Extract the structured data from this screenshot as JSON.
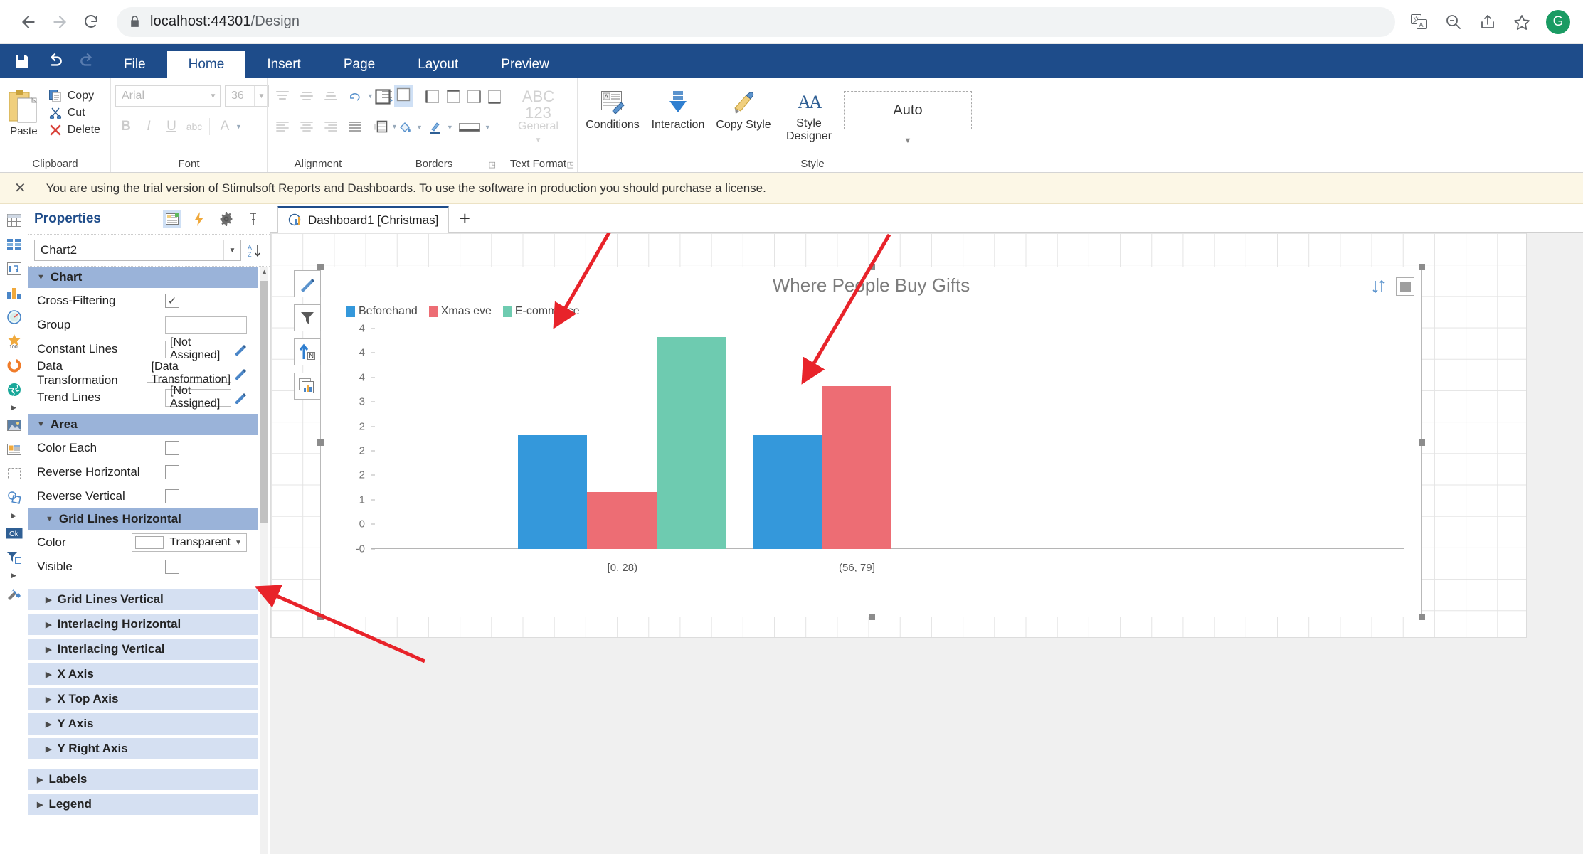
{
  "browser": {
    "url_host": "localhost:44301",
    "url_path": "/Design",
    "back_icon": "back-arrow-icon",
    "forward_icon": "forward-arrow-icon",
    "reload_icon": "reload-icon",
    "lock_icon": "lock-icon",
    "translate_icon": "translate-icon",
    "zoom_icon": "zoom-icon",
    "share_icon": "share-icon",
    "bookmark_icon": "star-icon",
    "avatar_letter": "G"
  },
  "ribbon": {
    "quick_access": [
      "save-icon",
      "undo-icon",
      "redo-icon"
    ],
    "tabs": [
      {
        "label": "File",
        "active": false
      },
      {
        "label": "Home",
        "active": true
      },
      {
        "label": "Insert",
        "active": false
      },
      {
        "label": "Page",
        "active": false
      },
      {
        "label": "Layout",
        "active": false
      },
      {
        "label": "Preview",
        "active": false
      }
    ],
    "groups": [
      {
        "name": "Clipboard"
      },
      {
        "name": "Font"
      },
      {
        "name": "Alignment"
      },
      {
        "name": "Borders"
      },
      {
        "name": "Text Format"
      },
      {
        "name": "Style"
      }
    ],
    "clipboard": {
      "paste": "Paste",
      "copy": "Copy",
      "cut": "Cut",
      "delete": "Delete"
    },
    "font": {
      "name_value": "Arial",
      "size_value": "36"
    },
    "text_format": {
      "sample_line1": "ABC",
      "sample_line2": "123",
      "sample_line3": "General"
    },
    "style": {
      "conditions": "Conditions",
      "interaction": "Interaction",
      "copy_style": "Copy Style",
      "style_designer": "Style\nDesigner",
      "style_designer_l1": "Style",
      "style_designer_l2": "Designer",
      "auto_value": "Auto"
    }
  },
  "trial": {
    "close_label": "✕",
    "message": "You are using the trial version of Stimulsoft Reports and Dashboards. To use the software in production you should purchase a license."
  },
  "rail_icons": [
    "table-icon",
    "blocks-icon",
    "form-icon",
    "chart-icon",
    "gauge-icon",
    "indicator-icon",
    "progress-icon",
    "map-icon",
    "more-icon-1",
    "image-icon",
    "panel-icon",
    "shape-icon",
    "shapes-icon",
    "more-icon-2",
    "button-icon",
    "filter-icon",
    "more-icon-3",
    "tools-icon"
  ],
  "properties": {
    "title": "Properties",
    "head_icons": [
      "properties-icon",
      "events-icon",
      "settings-icon",
      "pin-icon"
    ],
    "selected_object": "Chart2",
    "sort_icon": "sort-az-icon",
    "groups": [
      {
        "name": "Chart",
        "style": "dark",
        "expanded": true,
        "indent": false,
        "rows": [
          {
            "label": "Cross-Filtering",
            "type": "checkbox",
            "checked": true
          },
          {
            "label": "Group",
            "type": "textbox",
            "value": ""
          },
          {
            "label": "Constant Lines",
            "type": "textbox-edit",
            "value": "[Not Assigned]"
          },
          {
            "label": "Data Transformation",
            "type": "textbox-edit",
            "value": "[Data Transformation]"
          },
          {
            "label": "Trend Lines",
            "type": "textbox-edit",
            "value": "[Not Assigned]"
          }
        ]
      },
      {
        "name": "Area",
        "style": "dark",
        "expanded": true,
        "indent": false,
        "rows": [
          {
            "label": "Color Each",
            "type": "checkbox",
            "checked": false
          },
          {
            "label": "Reverse Horizontal",
            "type": "checkbox",
            "checked": false
          },
          {
            "label": "Reverse Vertical",
            "type": "checkbox",
            "checked": false
          }
        ]
      },
      {
        "name": "Grid Lines Horizontal",
        "style": "dark",
        "expanded": true,
        "indent": true,
        "rows": [
          {
            "label": "Color",
            "type": "color",
            "value": "Transparent"
          },
          {
            "label": "Visible",
            "type": "checkbox",
            "checked": false
          }
        ]
      },
      {
        "name": "Grid Lines Vertical",
        "style": "light",
        "expanded": false,
        "indent": true,
        "rows": []
      },
      {
        "name": "Interlacing Horizontal",
        "style": "light",
        "expanded": false,
        "indent": true,
        "rows": []
      },
      {
        "name": "Interlacing Vertical",
        "style": "light",
        "expanded": false,
        "indent": true,
        "rows": []
      },
      {
        "name": "X Axis",
        "style": "light",
        "expanded": false,
        "indent": true,
        "rows": []
      },
      {
        "name": "X Top Axis",
        "style": "light",
        "expanded": false,
        "indent": true,
        "rows": []
      },
      {
        "name": "Y Axis",
        "style": "light",
        "expanded": false,
        "indent": true,
        "rows": []
      },
      {
        "name": "Y Right Axis",
        "style": "light",
        "expanded": false,
        "indent": true,
        "rows": []
      },
      {
        "name": "Labels",
        "style": "light",
        "expanded": false,
        "indent": false,
        "rows": []
      },
      {
        "name": "Legend",
        "style": "light",
        "expanded": false,
        "indent": false,
        "rows": []
      }
    ]
  },
  "canvas": {
    "tab_label": "Dashboard1 [Christmas]",
    "tab_icon": "dashboard-icon",
    "add_tab_label": "+",
    "chart_tools": [
      "edit-pencil-icon",
      "filter-icon",
      "sort-n-icon",
      "chart-type-icon"
    ],
    "chart_top_right": [
      "sort-toggle-icon",
      "fullscreen-icon"
    ]
  },
  "chart_data": {
    "type": "bar",
    "title": "Where People Buy Gifts",
    "xlabel": "",
    "ylabel": "",
    "grid": false,
    "legend_position": "top-left",
    "categories": [
      "[0, 28)",
      "(56, 79]"
    ],
    "ytick_labels": [
      "4",
      "4",
      "4",
      "3",
      "2",
      "2",
      "2",
      "1",
      "0",
      "-0"
    ],
    "ylim": [
      0,
      4
    ],
    "series": [
      {
        "name": "Beforehand",
        "color": "#3498db",
        "values": [
          2,
          2
        ]
      },
      {
        "name": "Xmas eve",
        "color": "#ed6d74",
        "values": [
          1,
          3
        ]
      },
      {
        "name": "E-commerce",
        "color": "#6ecbb0",
        "values": [
          4,
          null
        ]
      }
    ],
    "bars": [
      {
        "series": "Beforehand",
        "category": "[0, 28)",
        "value": 2,
        "color": "#3498db"
      },
      {
        "series": "Xmas eve",
        "category": "[0, 28)",
        "value": 1,
        "color": "#ed6d74"
      },
      {
        "series": "E-commerce",
        "category": "[0, 28)",
        "value": 4,
        "color": "#6ecbb0"
      },
      {
        "series": "Beforehand",
        "category": "(56, 79]",
        "value": 2,
        "color": "#3498db"
      },
      {
        "series": "Xmas eve",
        "category": "(56, 79]",
        "value": 3,
        "color": "#ed6d74"
      }
    ]
  },
  "colors": {
    "ribbon_blue": "#1e4c8a",
    "group_header": "#9ab3d9",
    "group_header_light": "#d5e0f2",
    "annotation_red": "#e8232a",
    "series_blue": "#3498db",
    "series_red": "#ed6d74",
    "series_green": "#6ecbb0"
  }
}
